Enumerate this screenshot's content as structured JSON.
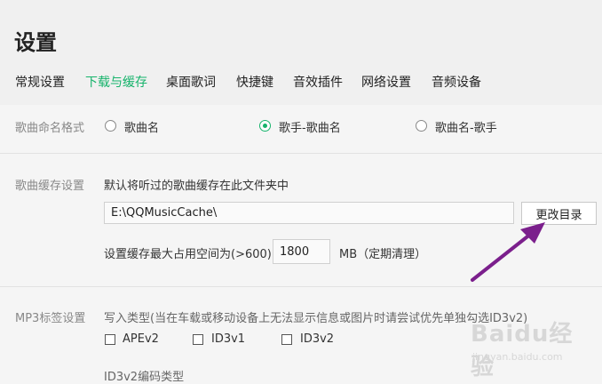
{
  "window": {
    "title": "设置"
  },
  "tabs": [
    {
      "label": "常规设置",
      "active": false
    },
    {
      "label": "下载与缓存",
      "active": true
    },
    {
      "label": "桌面歌词",
      "active": false
    },
    {
      "label": "快捷键",
      "active": false
    },
    {
      "label": "音效插件",
      "active": false
    },
    {
      "label": "网络设置",
      "active": false
    },
    {
      "label": "音频设备",
      "active": false
    }
  ],
  "naming": {
    "label": "歌曲命名格式",
    "options": [
      {
        "label": "歌曲名",
        "selected": false
      },
      {
        "label": "歌手-歌曲名",
        "selected": true
      },
      {
        "label": "歌曲名-歌手",
        "selected": false
      }
    ]
  },
  "cache": {
    "label": "歌曲缓存设置",
    "description": "默认将听过的歌曲缓存在此文件夹中",
    "path": "E:\\QQMusicCache\\",
    "change_button": "更改目录",
    "max_label": "设置缓存最大占用空间为(>600)",
    "max_value": "1800",
    "unit_note": "MB（定期清理）"
  },
  "mp3tag": {
    "label": "MP3标签设置",
    "write_type_label": "写入类型(当在车载或移动设备上无法显示信息或图片时请尝试优先单独勾选ID3v2)",
    "checkboxes": [
      {
        "label": "APEv2",
        "checked": false
      },
      {
        "label": "ID3v1",
        "checked": false
      },
      {
        "label": "ID3v2",
        "checked": false
      }
    ],
    "encoding_label": "ID3v2编码类型"
  },
  "watermark": {
    "main": "Baidu经验",
    "sub": "jingyan.baidu.com"
  },
  "colors": {
    "accent": "#16b36b",
    "annotation_arrow": "#7b1f8c"
  }
}
